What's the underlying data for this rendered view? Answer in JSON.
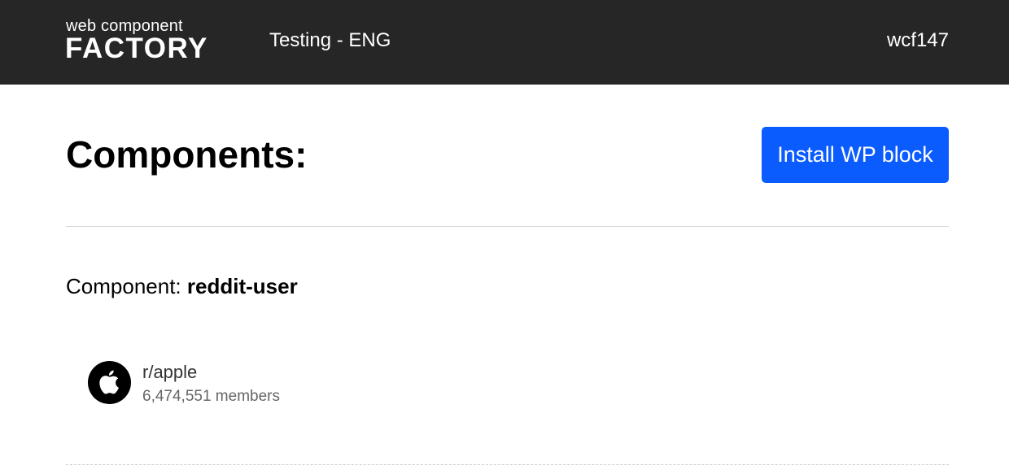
{
  "header": {
    "logo_small": "web component",
    "logo_big": "FACTORY",
    "project_title": "Testing - ENG",
    "user": "wcf147"
  },
  "main": {
    "page_title": "Components:",
    "install_button_label": "Install WP block",
    "component_label": "Component:",
    "component_name": "reddit-user"
  },
  "reddit_card": {
    "icon": "apple-logo-icon",
    "subreddit": "r/apple",
    "members": "6,474,551 members"
  },
  "colors": {
    "header_bg": "#262626",
    "accent": "#0b5cff"
  }
}
